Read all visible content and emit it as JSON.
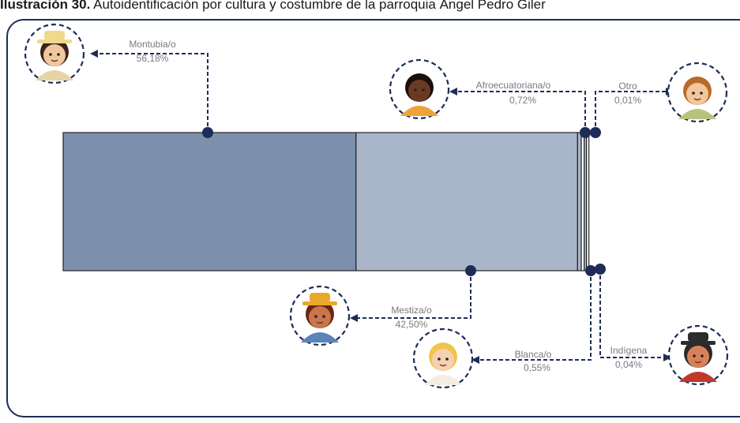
{
  "title": {
    "prefix": "Ilustración 30.",
    "text": " Autoidentificación por cultura y costumbre de la parroquia Ángel Pedro Giler"
  },
  "colors": {
    "bar_dark": "#7c90ad",
    "bar_light": "#a9b5c9",
    "connector": "#1d2d57"
  },
  "chart_data": {
    "type": "bar",
    "stacked": true,
    "orientation": "horizontal",
    "unit": "%",
    "categories": [
      "Montubia/o",
      "Mestiza/o",
      "Afroecuatoriana/o",
      "Blanca/o",
      "Indígena",
      "Otro"
    ],
    "values": [
      56.18,
      42.5,
      0.72,
      0.55,
      0.04,
      0.01
    ],
    "value_labels": [
      "56,18%",
      "42,50%",
      "0,72%",
      "0,55%",
      "0,04%",
      "0,01%"
    ],
    "segments": [
      {
        "name": "Montubia/o",
        "value": 56.18,
        "label": "56,18%",
        "callout": "top",
        "icon": "montubia-avatar-icon"
      },
      {
        "name": "Mestiza/o",
        "value": 42.5,
        "label": "42,50%",
        "callout": "bottom",
        "icon": "mestiza-avatar-icon"
      },
      {
        "name": "Afroecuatoriana/o",
        "value": 0.72,
        "label": "0,72%",
        "callout": "top",
        "icon": "afroecuatoriana-avatar-icon"
      },
      {
        "name": "Blanca/o",
        "value": 0.55,
        "label": "0,55%",
        "callout": "bottom",
        "icon": "blanca-avatar-icon"
      },
      {
        "name": "Indígena",
        "value": 0.04,
        "label": "0,04%",
        "callout": "bottom",
        "icon": "indigena-avatar-icon"
      },
      {
        "name": "Otro",
        "value": 0.01,
        "label": "0,01%",
        "callout": "top",
        "icon": "otro-avatar-icon"
      }
    ]
  }
}
